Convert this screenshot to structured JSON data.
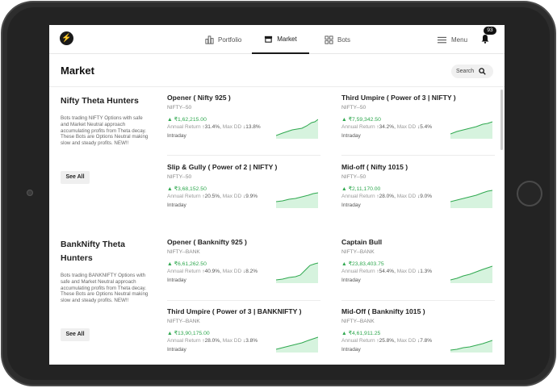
{
  "nav": {
    "portfolio": "Portfolio",
    "market": "Market",
    "bots": "Bots",
    "menu": "Menu",
    "notification_count": "93"
  },
  "page": {
    "title": "Market",
    "search_label": "Search"
  },
  "colors": {
    "positive": "#2fa84f",
    "chart_fill": "#d6f3de",
    "accent": "#1a1a1a"
  },
  "groups": [
    {
      "title": "Nifty Theta Hunters",
      "description": "Bots trading NIFTY Options with safe and Market Neutral approach accumulating profits from Theta decay. These Bots are Options Neutral making slow and steady profits. NEW!!",
      "see_all": "See All",
      "cards": [
        {
          "name": "Opener ( Nifty 925 )",
          "symbol": "NIFTY--50",
          "price": "▲ ₹1,62,215.00",
          "label": "Annual Return",
          "ret": "↑31.4%",
          "dd_label": "Max DD",
          "dd": "↓13.8%",
          "kind": "Intraday"
        },
        {
          "name": "Third Umpire ( Power of 3 | NIFTY )",
          "symbol": "NIFTY--50",
          "price": "▲ ₹7,59,342.50",
          "label": "Annual Return",
          "ret": "↑34.2%",
          "dd_label": "Max DD",
          "dd": "↓5.4%",
          "kind": "Intraday"
        },
        {
          "name": "Slip & Gully ( Power of 2 | NIFTY )",
          "symbol": "NIFTY--50",
          "price": "▲ ₹3,68,152.50",
          "label": "Annual Return",
          "ret": "↑20.5%",
          "dd_label": "Max DD",
          "dd": "↓9.9%",
          "kind": "Intraday"
        },
        {
          "name": "Mid-off ( Nifty 1015 )",
          "symbol": "NIFTY--50",
          "price": "▲ ₹2,11,170.00",
          "label": "Annual Return",
          "ret": "↑28.0%",
          "dd_label": "Max DD",
          "dd": "↓9.0%",
          "kind": "Intraday"
        }
      ]
    },
    {
      "title": "BankNifty Theta Hunters",
      "description": "Bots trading BANKNIFTY Options with safe and Market Neutral approach accumulating profits from Theta decay. These Bots are Options Neutral making slow and steady profits. NEW!!",
      "see_all": "See All",
      "cards": [
        {
          "name": "Opener ( Banknifty 925 )",
          "symbol": "NIFTY--BANK",
          "price": "▲ ₹6,61,262.50",
          "label": "Annual Return",
          "ret": "↑40.9%",
          "dd_label": "Max DD",
          "dd": "↓8.2%",
          "kind": "Intraday"
        },
        {
          "name": "Captain Bull",
          "symbol": "NIFTY--BANK",
          "price": "▲ ₹23,83,403.75",
          "label": "Annual Return",
          "ret": "↑54.4%",
          "dd_label": "Max DD",
          "dd": "↓1.3%",
          "kind": "Intraday"
        },
        {
          "name": "Third Umpire ( Power of 3 | BANKNIFTY )",
          "symbol": "NIFTY--BANK",
          "price": "▲ ₹13,90,175.00",
          "label": "Annual Return",
          "ret": "↑28.0%",
          "dd_label": "Max DD",
          "dd": "↓3.8%",
          "kind": "Intraday"
        },
        {
          "name": "Mid-Off ( Banknifty 1015 )",
          "symbol": "NIFTY--BANK",
          "price": "▲ ₹4,61,911.25",
          "label": "Annual Return",
          "ret": "↑25.8%",
          "dd_label": "Max DD",
          "dd": "↓7.8%",
          "kind": "Intraday"
        }
      ]
    }
  ]
}
